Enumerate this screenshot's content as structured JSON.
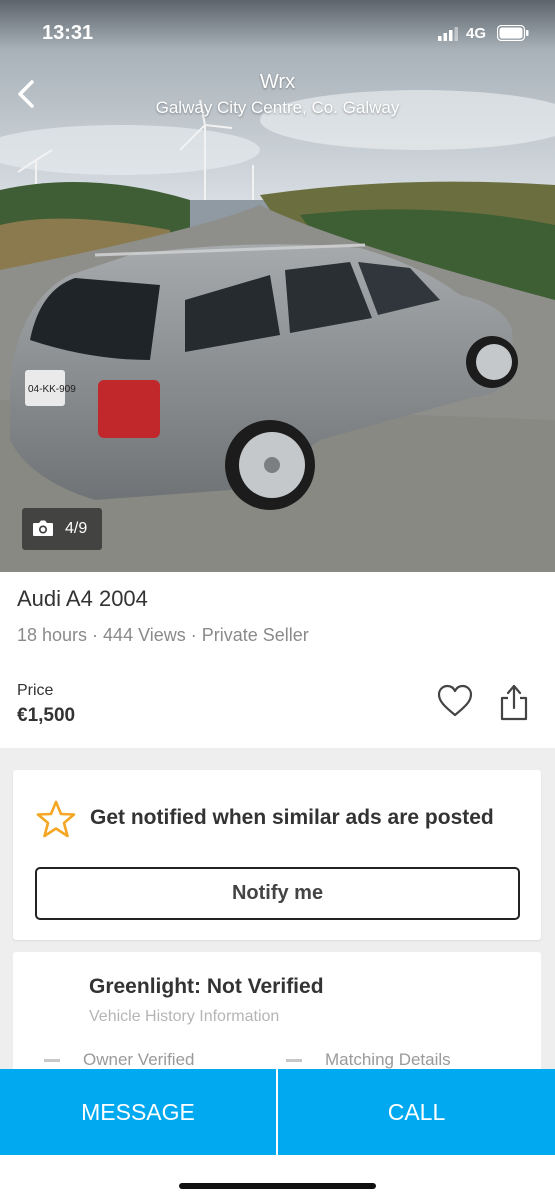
{
  "status_bar": {
    "time": "13:31",
    "network": "4G",
    "signal_icon": "cellular-signal-icon",
    "battery_icon": "battery-icon"
  },
  "header": {
    "back_icon": "chevron-left-icon",
    "title": "Wrx",
    "location": "Galway City Centre, Co. Galway"
  },
  "gallery": {
    "camera_icon": "camera-icon",
    "counter": "4/9",
    "plate_text": "04-KK-909"
  },
  "listing": {
    "title": "Audi A4 2004",
    "meta": "18 hours · 444 Views · Private Seller",
    "price_label": "Price",
    "price": "€1,500",
    "favourite_icon": "heart-icon",
    "share_icon": "share-icon"
  },
  "notify": {
    "star_icon": "star-icon",
    "text": "Get notified when similar ads are posted",
    "button_label": "Notify me",
    "star_color": "#f5a623"
  },
  "greenlight": {
    "title": "Greenlight: Not Verified",
    "subtitle": "Vehicle History Information",
    "items": [
      "Owner Verified",
      "Matching Details"
    ]
  },
  "actions": {
    "message_label": "MESSAGE",
    "call_label": "CALL",
    "accent_color": "#00a9f0"
  }
}
